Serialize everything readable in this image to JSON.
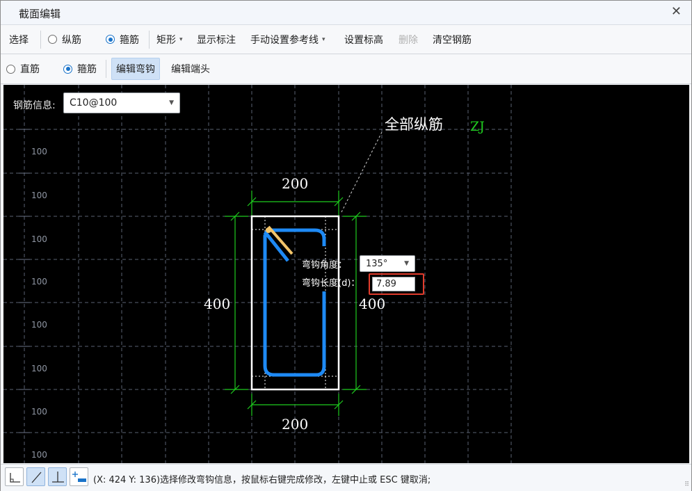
{
  "window": {
    "title": "截面编辑",
    "close_glyph": "✕"
  },
  "toolbar1": {
    "select": "选择",
    "longitudinal": "纵筋",
    "stirrup": "箍筋",
    "shape": "矩形",
    "show_dims": "显示标注",
    "manual_ref": "手动设置参考线",
    "set_elev": "设置标高",
    "delete": "删除",
    "clear": "清空钢筋"
  },
  "toolbar2": {
    "straight": "直筋",
    "stirrup": "箍筋",
    "edit_hook": "编辑弯钩",
    "edit_end": "编辑端头"
  },
  "canvas": {
    "rebar_info_label": "钢筋信息:",
    "rebar_info_value": "C10@100",
    "grid_labels": [
      "100",
      "100",
      "100",
      "100",
      "100",
      "100",
      "100",
      "100"
    ],
    "dim_top": "200",
    "dim_bottom": "200",
    "dim_left": "400",
    "dim_right": "400",
    "callout_label": "全部纵筋",
    "callout_code": "ZJ",
    "hook_angle_label": "弯钩角度：",
    "hook_angle_value": "135°",
    "hook_length_label": "弯钩长度(d)：",
    "hook_length_value": "7.89"
  },
  "colors": {
    "section_outline": "#ffffff",
    "stirrup": "#1e8af5",
    "dimension": "#1fcc1f",
    "hook_highlight": "#f2c46a",
    "callout_code": "#1fcc1f",
    "grid": "#5a6272",
    "input_highlight": "#e23c2c"
  },
  "statusbar": {
    "text": "(X: 424 Y: 136)选择修改弯钩信息，按鼠标右键完成修改，左键中止或 ESC 键取消;",
    "buttons": [
      "orthogonal-icon",
      "slant-line-icon",
      "perpendicular-icon",
      "add-point-icon"
    ]
  }
}
